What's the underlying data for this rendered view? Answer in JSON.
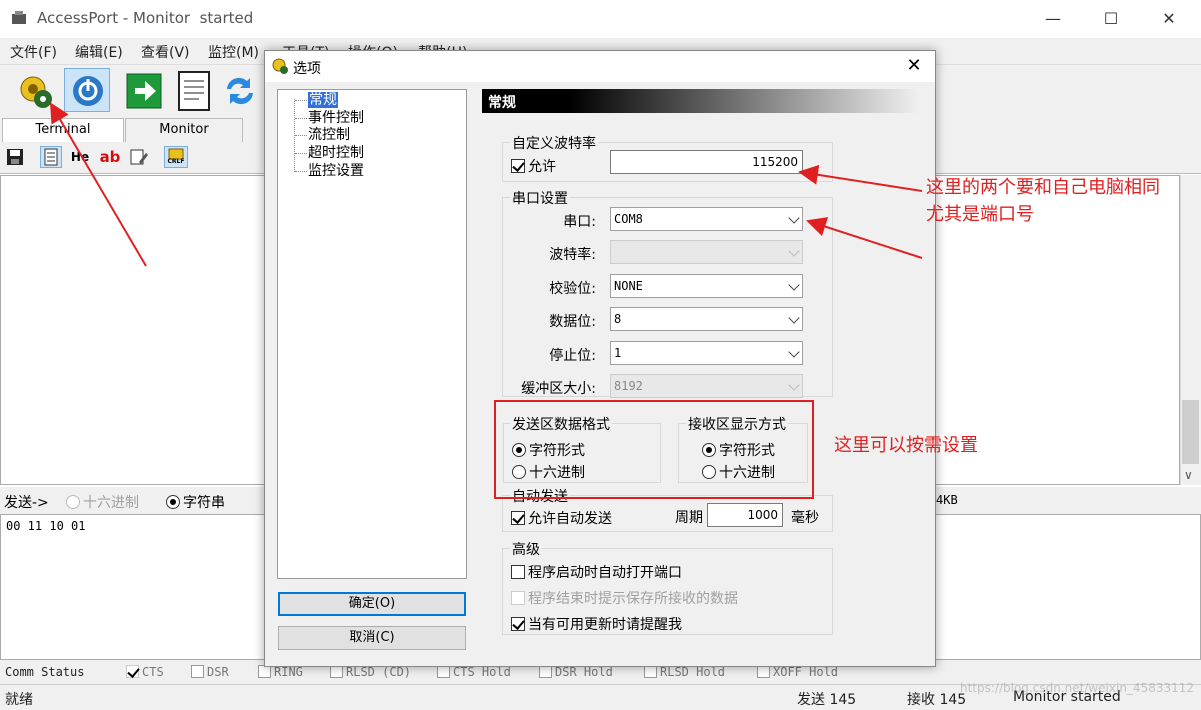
{
  "app": {
    "title": "AccessPort - Monitor  started",
    "window_controls": {
      "minimize": "—",
      "maximize": "☐",
      "close": "✕"
    }
  },
  "menu": [
    "文件(F)",
    "编辑(E)",
    "查看(V)",
    "监控(M)",
    "工具(T)",
    "操作(O)",
    "帮助(H)"
  ],
  "tabs": {
    "terminal": "Terminal",
    "monitor": "Monitor"
  },
  "toolbar2": {
    "hex": "He",
    "ab": "ab",
    "crlf": "CRLF"
  },
  "send_row": {
    "label": "发送->",
    "hex": "十六进制",
    "string": "字符串",
    "buffer": "4KB"
  },
  "send_area": {
    "content": "00 11 10 01"
  },
  "status_pins": {
    "label": "Comm Status",
    "items": [
      "CTS",
      "DSR",
      "RING",
      "RLSD (CD)",
      "CTS Hold",
      "DSR Hold",
      "RLSD Hold",
      "XOFF Hold"
    ]
  },
  "statusbar": {
    "ready": "就绪",
    "sent": "发送 145",
    "received": "接收 145",
    "state": "Monitor  started",
    "watermark": "https://blog.csdn.net/weixin_45833112"
  },
  "dialog": {
    "title": "选项",
    "tree": [
      "常规",
      "事件控制",
      "流控制",
      "超时控制",
      "监控设置"
    ],
    "ok": "确定(O)",
    "cancel": "取消(C)",
    "panel_title": "常规",
    "custom_baud": {
      "group": "自定义波特率",
      "allow": "允许",
      "value": "115200"
    },
    "port_settings": {
      "group": "串口设置",
      "fields": [
        {
          "label": "串口:",
          "value": "COM8"
        },
        {
          "label": "波特率:",
          "value": ""
        },
        {
          "label": "校验位:",
          "value": "NONE"
        },
        {
          "label": "数据位:",
          "value": "8"
        },
        {
          "label": "停止位:",
          "value": "1"
        },
        {
          "label": "缓冲区大小:",
          "value": "8192"
        }
      ]
    },
    "send_format": {
      "group": "发送区数据格式",
      "char": "字符形式",
      "hex": "十六进制"
    },
    "recv_format": {
      "group": "接收区显示方式",
      "char": "字符形式",
      "hex": "十六进制"
    },
    "auto_send": {
      "group": "自动发送",
      "allow": "允许自动发送",
      "period_label": "周期",
      "period_value": "1000",
      "unit": "毫秒"
    },
    "advanced": {
      "group": "高级",
      "opt1": "程序启动时自动打开端口",
      "opt2": "程序结束时提示保存所接收的数据",
      "opt3": "当有可用更新时请提醒我"
    }
  },
  "annotations": {
    "note1_line1": "这里的两个要和自己电脑相同",
    "note1_line2": "尤其是端口号",
    "note2": "这里可以按需设置"
  },
  "colors": {
    "annotation": "#e02020",
    "selection": "#3070d8",
    "focus": "#0078d7"
  }
}
